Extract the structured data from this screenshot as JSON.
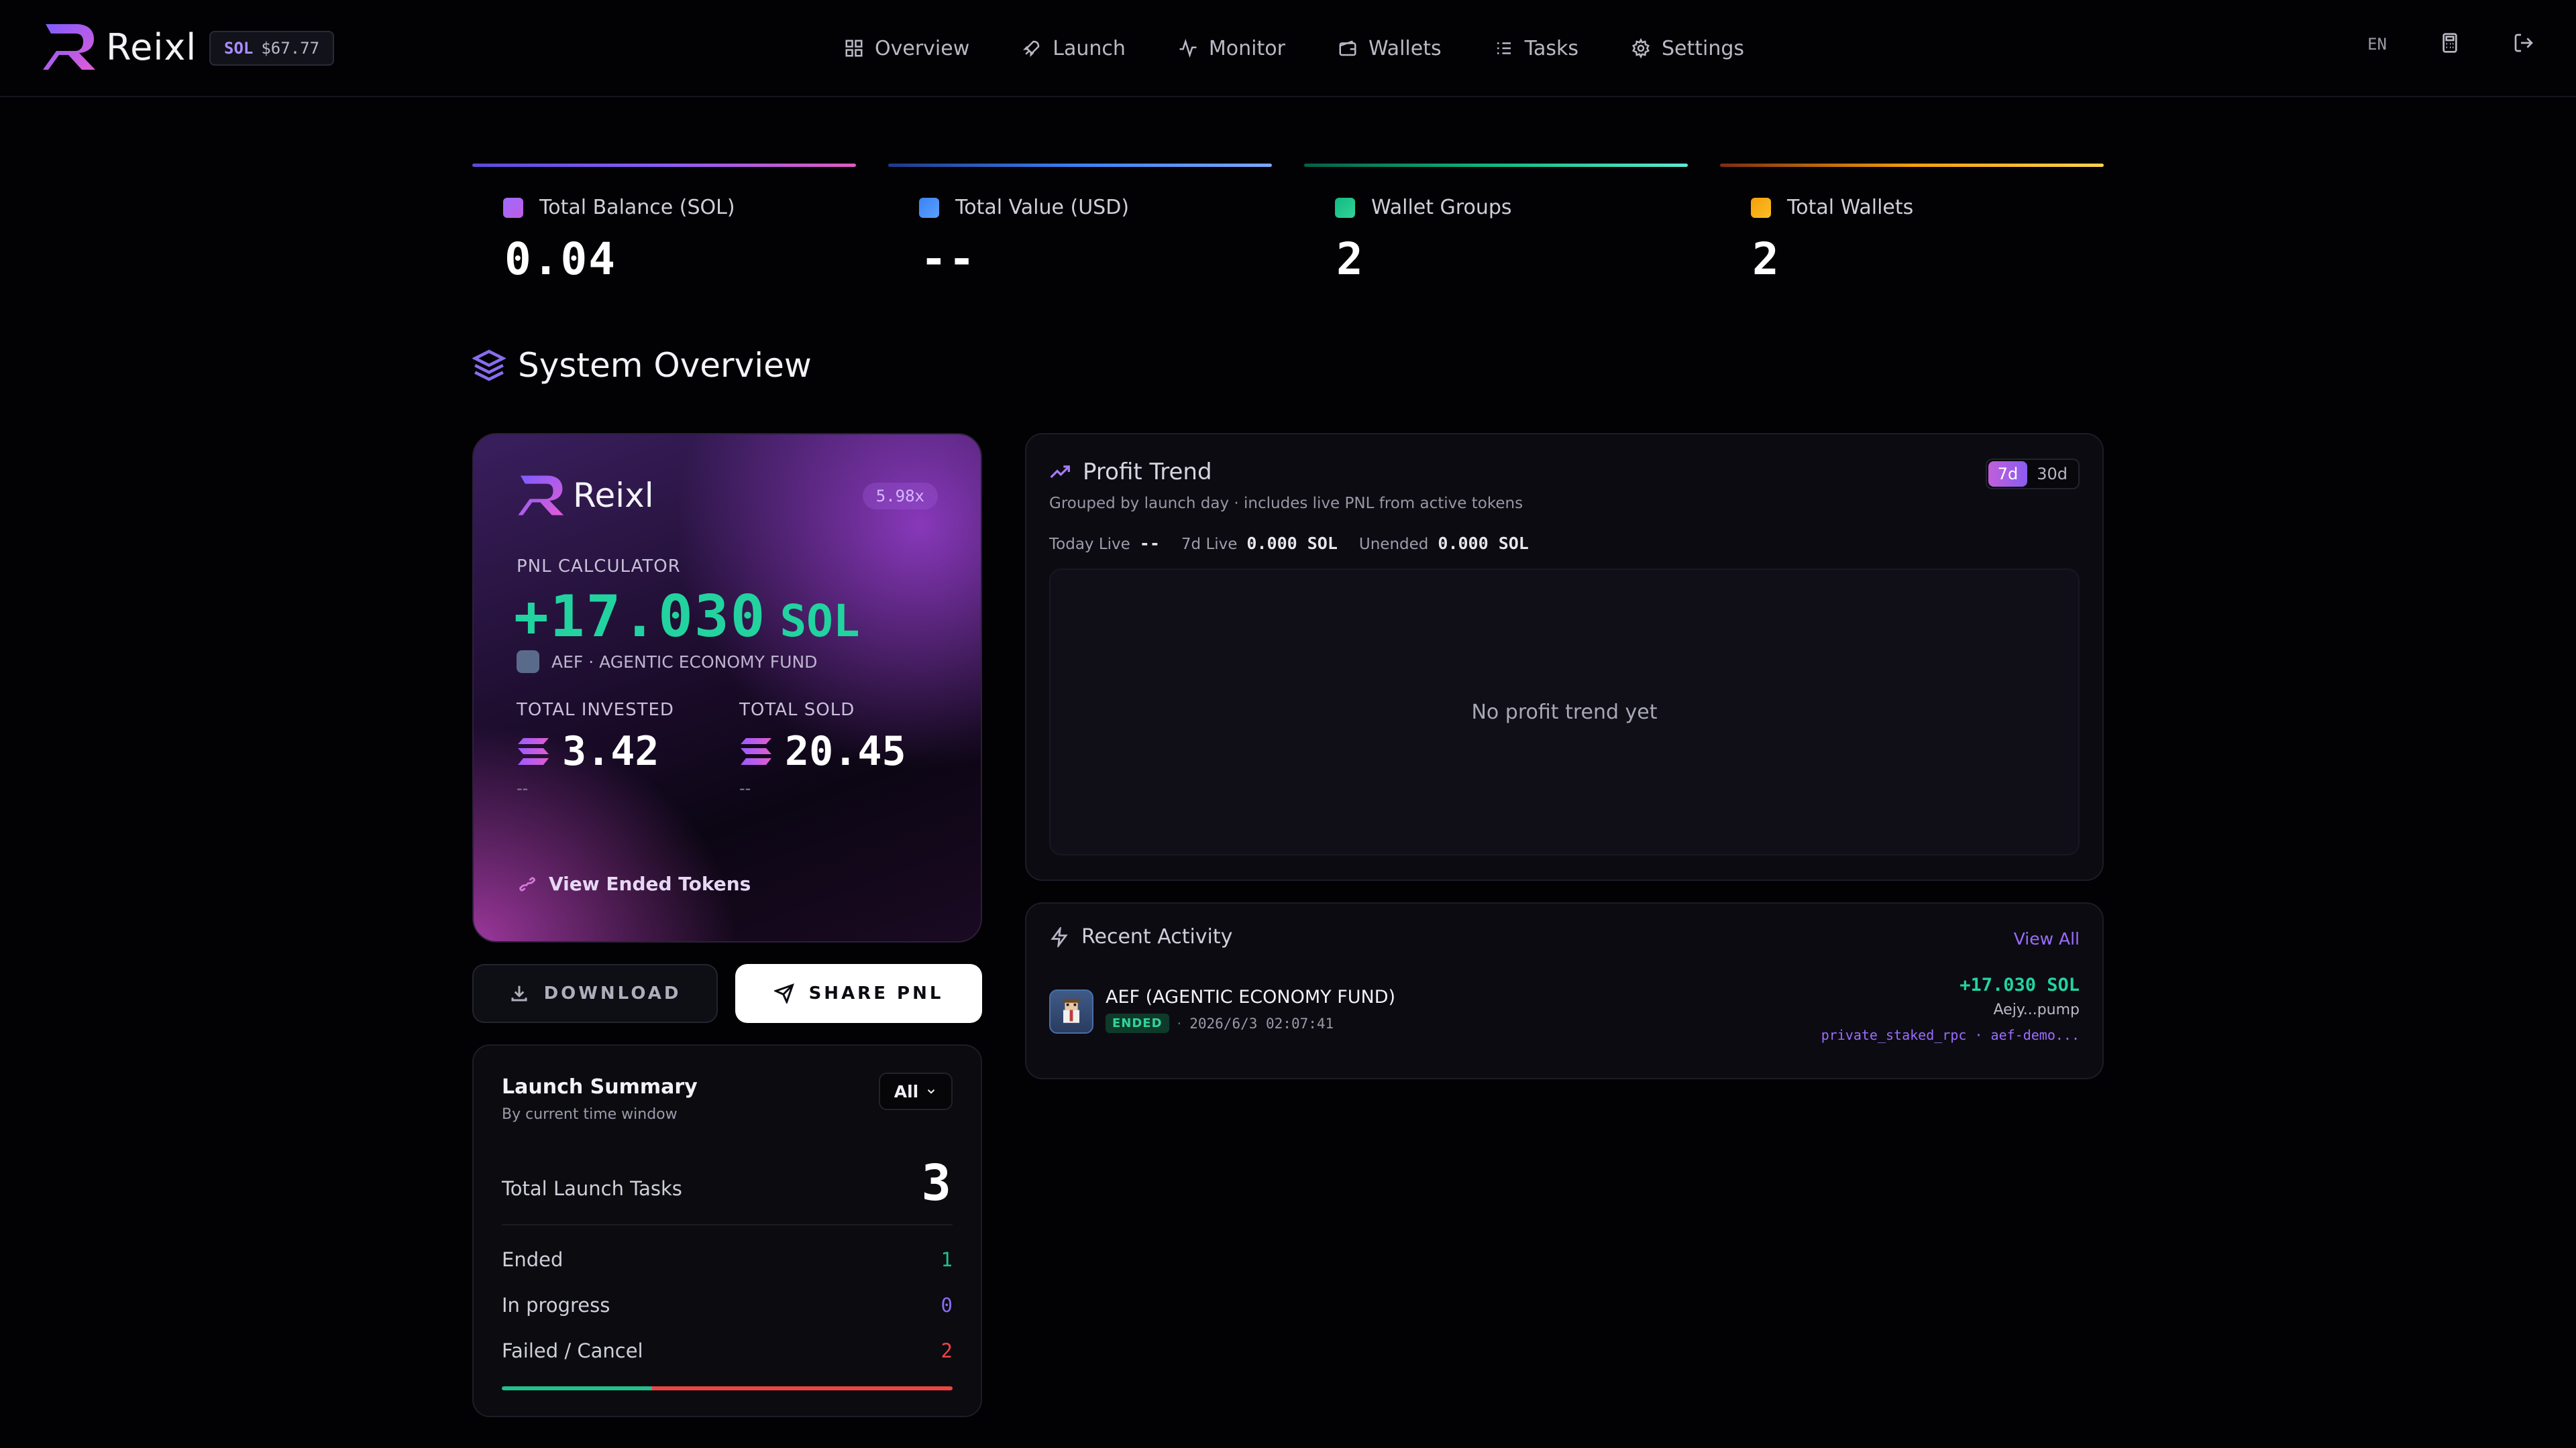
{
  "app": {
    "name": "Reixl",
    "sol_chip": {
      "label": "SOL",
      "price": "$67.77"
    }
  },
  "nav": [
    {
      "label": "Overview",
      "icon": "grid-icon"
    },
    {
      "label": "Launch",
      "icon": "rocket-icon"
    },
    {
      "label": "Monitor",
      "icon": "activity-icon"
    },
    {
      "label": "Wallets",
      "icon": "wallet-icon"
    },
    {
      "label": "Tasks",
      "icon": "list-icon"
    },
    {
      "label": "Settings",
      "icon": "gear-icon"
    }
  ],
  "top_right": {
    "lang": "EN",
    "calculator_icon": "calculator-icon",
    "logout_icon": "logout-icon"
  },
  "stats": [
    {
      "label": "Total Balance (SOL)",
      "value": "0.04",
      "accent": "#8b5cf6"
    },
    {
      "label": "Total Value (USD)",
      "value": "--",
      "accent": "#3b82f6"
    },
    {
      "label": "Wallet Groups",
      "value": "2",
      "accent": "#10b981"
    },
    {
      "label": "Total Wallets",
      "value": "2",
      "accent": "#f59e0b"
    }
  ],
  "section_title": "System Overview",
  "pnl_card": {
    "brand": "Reixl",
    "multiplier": "5.98x",
    "calc_label": "PNL CALCULATOR",
    "pnl_value": "+17.030",
    "pnl_unit": "SOL",
    "token": "AEF · AGENTIC ECONOMY FUND",
    "invested": {
      "label": "TOTAL INVESTED",
      "value": "3.42",
      "sub": "--"
    },
    "sold": {
      "label": "TOTAL SOLD",
      "value": "20.45",
      "sub": "--"
    },
    "link": "View Ended Tokens"
  },
  "buttons": {
    "download": "DOWNLOAD",
    "share": "SHARE PNL"
  },
  "launch_summary": {
    "title": "Launch Summary",
    "subtitle": "By current time window",
    "filter": "All",
    "total_label": "Total Launch Tasks",
    "total_value": "3",
    "rows": [
      {
        "label": "Ended",
        "value": "1",
        "color": "#22c08a"
      },
      {
        "label": "In progress",
        "value": "0",
        "color": "#8b6cf6"
      },
      {
        "label": "Failed / Cancel",
        "value": "2",
        "color": "#ef4444"
      }
    ],
    "progress": {
      "ended": 1,
      "in_progress": 0,
      "failed": 2
    }
  },
  "profit_trend": {
    "title": "Profit Trend",
    "subtitle": "Grouped by launch day · includes live PNL from active tokens",
    "ranges": [
      "7d",
      "30d"
    ],
    "active_range": "7d",
    "today_label": "Today Live",
    "today_value": "--",
    "week_label": "7d Live",
    "week_value": "0.000 SOL",
    "unended_label": "Unended",
    "unended_value": "0.000 SOL",
    "empty_text": "No profit trend yet"
  },
  "recent_activity": {
    "title": "Recent Activity",
    "view_all": "View All",
    "items": [
      {
        "name": "AEF (AGENTIC ECONOMY FUND)",
        "status": "ENDED",
        "time": "2026/6/3 02:07:41",
        "pnl": "+17.030 SOL",
        "address": "Aejy...pump",
        "route": "private_staked_rpc · aef-demo..."
      }
    ]
  }
}
